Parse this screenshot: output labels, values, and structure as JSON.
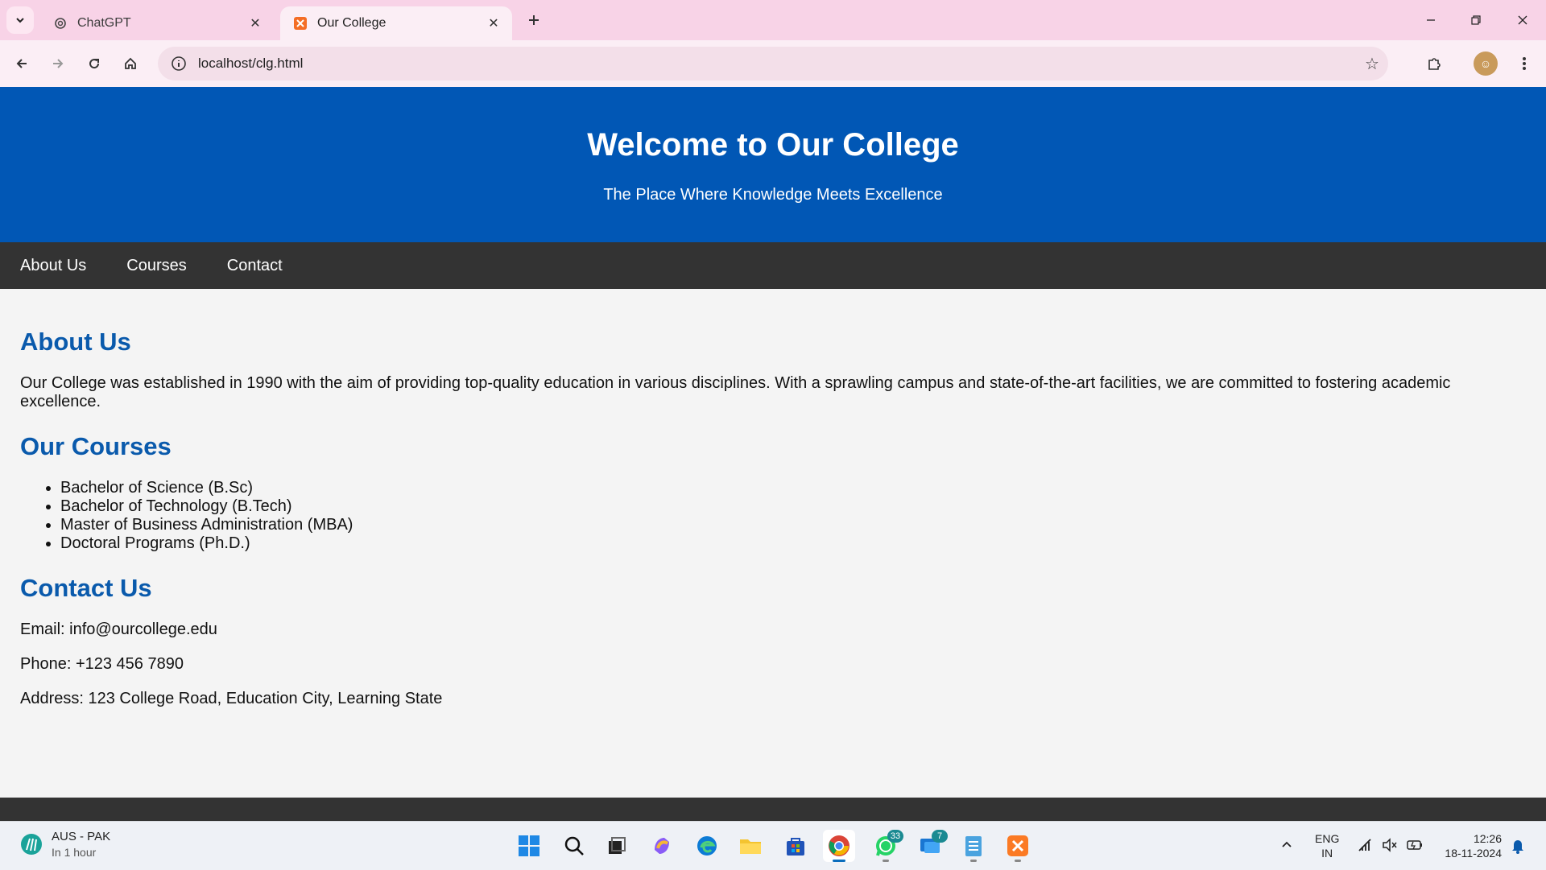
{
  "browser": {
    "tabs": [
      {
        "label": "ChatGPT",
        "favicon": "chatgpt-icon"
      },
      {
        "label": "Our College",
        "favicon": "xampp-icon",
        "active": true
      }
    ],
    "url": "localhost/clg.html"
  },
  "page": {
    "header": {
      "title": "Welcome to Our College",
      "subtitle": "The Place Where Knowledge Meets Excellence"
    },
    "nav": [
      "About Us",
      "Courses",
      "Contact"
    ],
    "about": {
      "heading": "About Us",
      "text": "Our College was established in 1990 with the aim of providing top-quality education in various disciplines. With a sprawling campus and state-of-the-art facilities, we are committed to fostering academic excellence."
    },
    "courses": {
      "heading": "Our Courses",
      "items": [
        "Bachelor of Science (B.Sc)",
        "Bachelor of Technology (B.Tech)",
        "Master of Business Administration (MBA)",
        "Doctoral Programs (Ph.D.)"
      ]
    },
    "contact": {
      "heading": "Contact Us",
      "email": "Email: info@ourcollege.edu",
      "phone": "Phone: +123 456 7890",
      "address": "Address: 123 College Road, Education City, Learning State"
    }
  },
  "taskbar": {
    "weather": {
      "title": "AUS - PAK",
      "subtitle": "In 1 hour"
    },
    "badges": {
      "whatsapp": "33",
      "messages": "7"
    },
    "lang": {
      "line1": "ENG",
      "line2": "IN"
    },
    "clock": {
      "time": "12:26",
      "date": "18-11-2024"
    }
  },
  "colors": {
    "header_bg": "#0157b5",
    "nav_bg": "#333333",
    "heading": "#0a5aac",
    "tabstrip": "#f8d3e7"
  }
}
